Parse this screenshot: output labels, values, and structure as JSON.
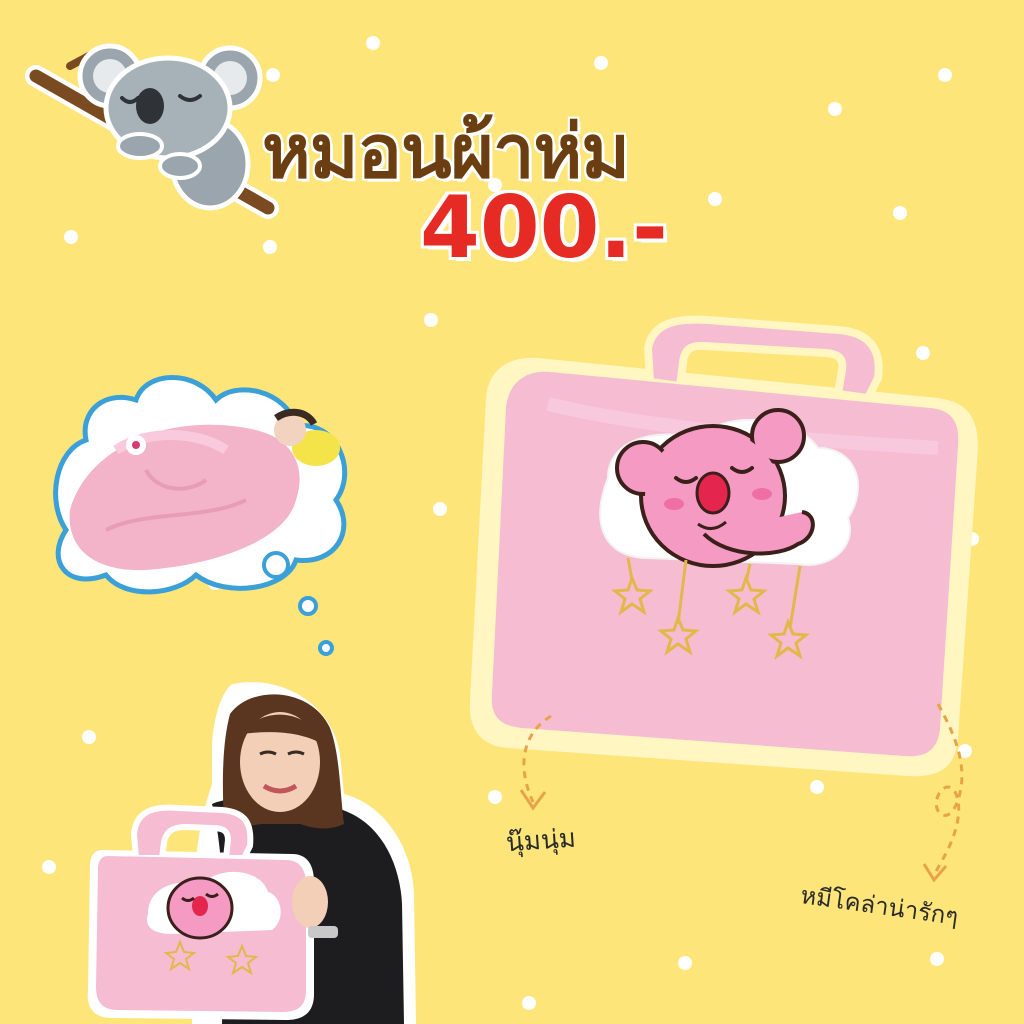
{
  "title": "หมอนผ้าห่ม",
  "price": "400.-",
  "labels": {
    "soft": "นุ๊มนุ่ม",
    "cute_koala": "หมีโคล่าน่ารักๆ"
  },
  "icons": {
    "koala_mascot": "koala-on-branch-icon",
    "thought_cloud": "thought-bubble-icon"
  },
  "colors": {
    "background": "#fde57a",
    "title": "#6b3e12",
    "price": "#e62b24",
    "product_pink": "#f6bcd2",
    "bubble_outline": "#3b9fd8"
  }
}
